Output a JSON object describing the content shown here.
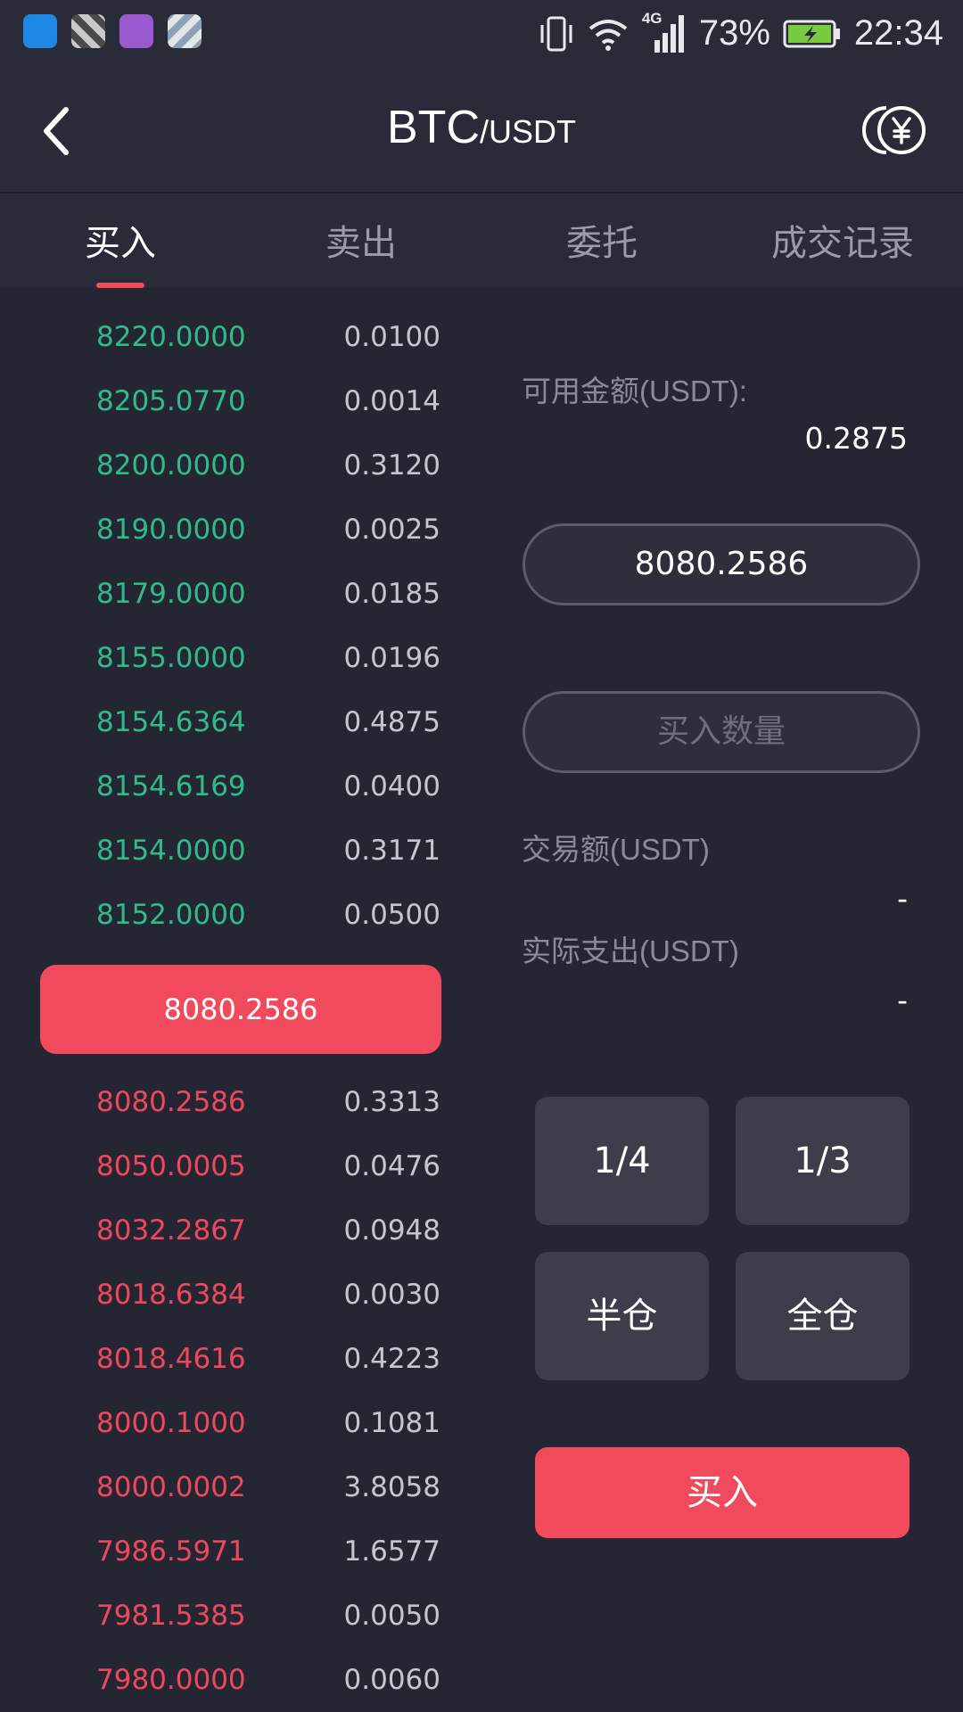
{
  "status_bar": {
    "battery": "73%",
    "time": "22:34",
    "network": "4G"
  },
  "header": {
    "base": "BTC",
    "quote": "/USDT"
  },
  "tabs": [
    {
      "label": "买入"
    },
    {
      "label": "卖出"
    },
    {
      "label": "委托"
    },
    {
      "label": "成交记录"
    }
  ],
  "order_book": {
    "asks": [
      {
        "price": "8220.0000",
        "qty": "0.0100"
      },
      {
        "price": "8205.0770",
        "qty": "0.0014"
      },
      {
        "price": "8200.0000",
        "qty": "0.3120"
      },
      {
        "price": "8190.0000",
        "qty": "0.0025"
      },
      {
        "price": "8179.0000",
        "qty": "0.0185"
      },
      {
        "price": "8155.0000",
        "qty": "0.0196"
      },
      {
        "price": "8154.6364",
        "qty": "0.4875"
      },
      {
        "price": "8154.6169",
        "qty": "0.0400"
      },
      {
        "price": "8154.0000",
        "qty": "0.3171"
      },
      {
        "price": "8152.0000",
        "qty": "0.0500"
      }
    ],
    "last_price": "8080.2586",
    "bids": [
      {
        "price": "8080.2586",
        "qty": "0.3313"
      },
      {
        "price": "8050.0005",
        "qty": "0.0476"
      },
      {
        "price": "8032.2867",
        "qty": "0.0948"
      },
      {
        "price": "8018.6384",
        "qty": "0.0030"
      },
      {
        "price": "8018.4616",
        "qty": "0.4223"
      },
      {
        "price": "8000.1000",
        "qty": "0.1081"
      },
      {
        "price": "8000.0002",
        "qty": "3.8058"
      },
      {
        "price": "7986.5971",
        "qty": "1.6577"
      },
      {
        "price": "7981.5385",
        "qty": "0.0050"
      },
      {
        "price": "7980.0000",
        "qty": "0.0060"
      }
    ]
  },
  "panel": {
    "available_label": "可用金额(USDT):",
    "available_value": "0.2875",
    "price_input_value": "8080.2586",
    "qty_placeholder": "买入数量",
    "trade_amount_label": "交易额(USDT)",
    "trade_amount_value": "-",
    "actual_cost_label": "实际支出(USDT)",
    "actual_cost_value": "-",
    "fractions": [
      {
        "label": "1/4"
      },
      {
        "label": "1/3"
      },
      {
        "label": "半仓"
      },
      {
        "label": "全仓"
      }
    ],
    "submit_label": "买入"
  },
  "colors": {
    "ask_green": "#2fbb8a",
    "bid_red": "#f0485b",
    "accent_red": "#f04a5c",
    "background": "#252633"
  }
}
